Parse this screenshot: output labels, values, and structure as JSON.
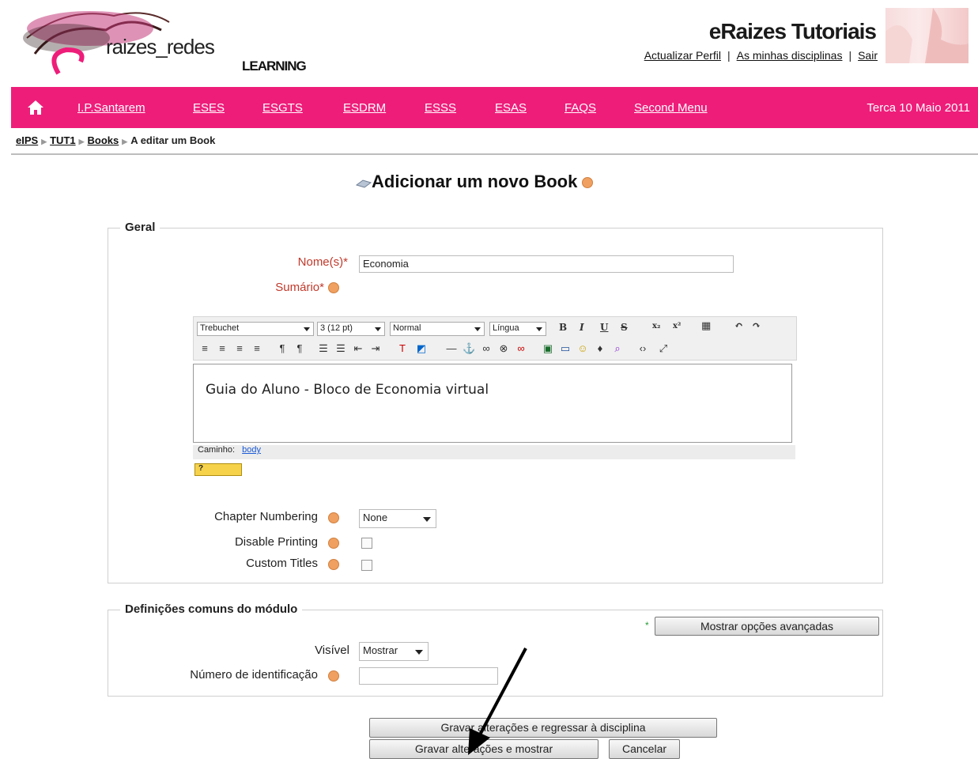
{
  "header": {
    "logo_text": "raizes_redes",
    "logo_subtext": "LEARNING",
    "site_title": "eRaizes Tutoriais",
    "links": [
      "Actualizar Perfil",
      "As minhas disciplinas",
      "Sair"
    ],
    "separator": "|"
  },
  "navbar": {
    "items": [
      "I.P.Santarem",
      "ESES",
      "ESGTS",
      "ESDRM",
      "ESSS",
      "ESAS",
      "FAQS",
      "Second Menu"
    ],
    "date": "Terca 10 Maio 2011",
    "bg_color": "#ee1d7a"
  },
  "breadcrumb": {
    "items": [
      "eIPS",
      "TUT1",
      "Books"
    ],
    "current": "A editar um Book"
  },
  "page": {
    "title": "Adicionar um novo Book"
  },
  "general": {
    "legend": "Geral",
    "name_label": "Nome(s)",
    "name_value": "Economia",
    "summary_label": "Sumário",
    "required_mark": "*",
    "editor": {
      "font": "Trebuchet",
      "size": "3 (12 pt)",
      "format": "Normal",
      "language": "Língua",
      "content": "Guia do Aluno - Bloco de Economia virtual",
      "path_label": "Caminho:",
      "path_value": "body"
    },
    "chapter_numbering_label": "Chapter Numbering",
    "chapter_numbering_value": "None",
    "disable_printing_label": "Disable Printing",
    "custom_titles_label": "Custom Titles"
  },
  "module": {
    "legend": "Definições comuns do módulo",
    "advanced_button": "Mostrar opções avançadas",
    "visible_label": "Visível",
    "visible_value": "Mostrar",
    "id_label": "Número de identificação",
    "id_value": ""
  },
  "actions": {
    "save_return": "Gravar alterações e regressar à disciplina",
    "save_show": "Gravar alterações e mostrar",
    "cancel": "Cancelar"
  }
}
